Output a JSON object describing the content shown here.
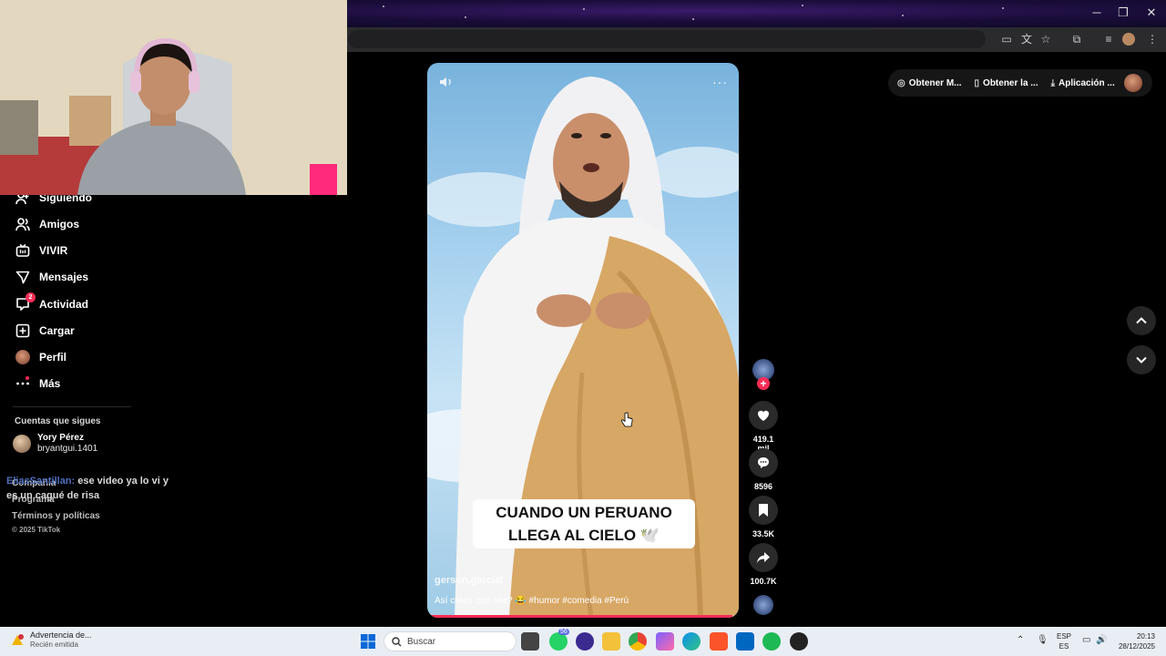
{
  "browser": {
    "window_controls": {
      "minimize": "─",
      "maximize": "❐",
      "close": "✕"
    }
  },
  "sidebar": {
    "items": [
      {
        "label": "Siguiendo",
        "icon": "following-icon"
      },
      {
        "label": "Amigos",
        "icon": "friends-icon"
      },
      {
        "label": "VIVIR",
        "icon": "live-icon"
      },
      {
        "label": "Mensajes",
        "icon": "messages-icon"
      },
      {
        "label": "Actividad",
        "icon": "activity-icon",
        "badge": "2"
      },
      {
        "label": "Cargar",
        "icon": "upload-icon"
      },
      {
        "label": "Perfil",
        "icon": "profile-icon"
      },
      {
        "label": "Más",
        "icon": "more-icon"
      }
    ],
    "follows_title": "Cuentas que sigues",
    "followed_user": {
      "name": "Yory Pérez",
      "handle": "bryantgui.1401"
    },
    "footer": [
      "Compañía",
      "Programa",
      "Términos y políticas"
    ],
    "copyright": "© 2025 TikTok"
  },
  "chat_overlay": {
    "username": "EliasSantillan:",
    "message_line1": "ese video ya lo vi y",
    "message_line2": "es un cagué de risa"
  },
  "video": {
    "caption_line1": "CUANDO UN PERUANO",
    "caption_line2": "LLEGA AL CIELO 🕊️",
    "author": "gerson.garcial",
    "description": "Así crees que sea? 😂 #humor #comedia #Perú",
    "progress": 0.98
  },
  "actions": {
    "likes": "419.1 mil",
    "comments": "8596",
    "saves": "33.5K",
    "shares": "100.7K"
  },
  "top_links": [
    "Obtener M...",
    "Obtener la ...",
    "Aplicación ..."
  ],
  "taskbar": {
    "notification_title": "Advertencia de...",
    "notification_sub": "Recién emitida",
    "notification_badge": "1",
    "search_placeholder": "Buscar",
    "whatsapp_badge": "56",
    "lang_top": "ESP",
    "lang_bottom": "ES",
    "time": "20:13",
    "date": "28/12/2025"
  },
  "colors": {
    "accent": "#fe2c55",
    "background": "#000000"
  }
}
